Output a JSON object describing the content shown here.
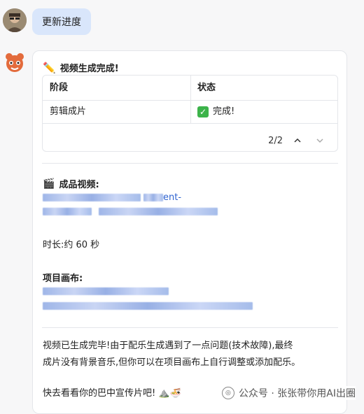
{
  "user_message": "更新进度",
  "bot": {
    "title_icon": "✏️",
    "title": "视频生成完成!",
    "table": {
      "headers": [
        "阶段",
        "状态"
      ],
      "rows": [
        [
          "剪辑成片",
          "完成!"
        ]
      ],
      "pager": "2/2"
    },
    "video_icon": "🎬",
    "video_label": "成品视频:",
    "video_link_suffix": "ent-",
    "duration": "时长:约 60 秒",
    "canvas_label": "项目画布:",
    "message_lines": [
      "视频已生成完毕!由于配乐生成遇到了一点问题(技术故障),最终",
      "成片没有背景音乐,但你可以在项目画布上自行调整或添加配乐。"
    ],
    "closing": "快去看看你的巴中宣传片吧!",
    "closing_emoji": "⛰️🍜"
  },
  "watermark": "公众号 · 张张带你用AI出圈"
}
